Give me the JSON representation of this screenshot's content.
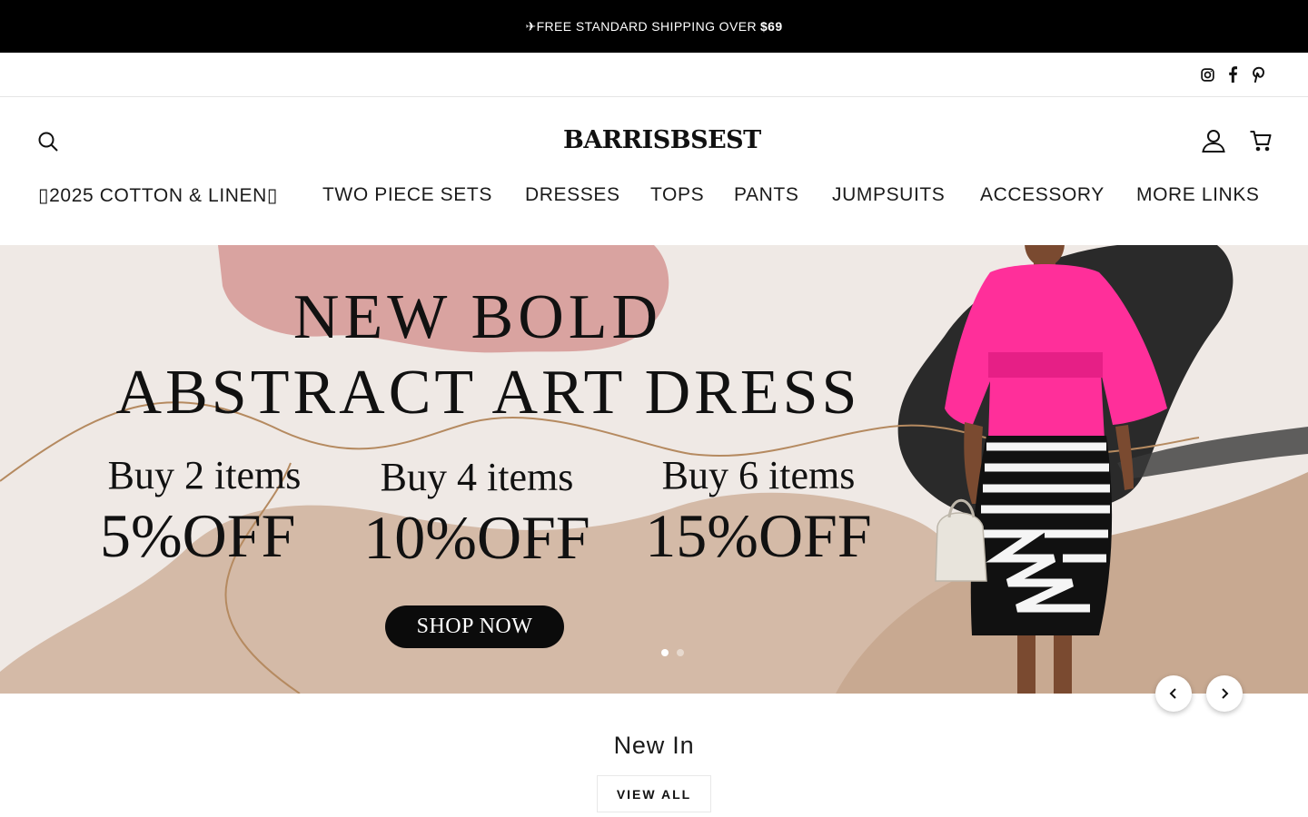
{
  "announcement": {
    "prefix": "✈FREE STANDARD SHIPPING OVER",
    "amount": "$69"
  },
  "social": {
    "icons": [
      "instagram-icon",
      "facebook-icon",
      "pinterest-icon"
    ]
  },
  "header": {
    "logo_text": "BARRISBSEST",
    "icons": {
      "search": "search-icon",
      "account": "user-icon",
      "cart": "cart-icon"
    }
  },
  "nav": {
    "items": [
      {
        "label": "▯2025 COTTON & LINEN▯"
      },
      {
        "label": "TWO PIECE SETS"
      },
      {
        "label": "DRESSES"
      },
      {
        "label": "TOPS"
      },
      {
        "label": "PANTS"
      },
      {
        "label": "JUMPSUITS"
      },
      {
        "label": "ACCESSORY"
      },
      {
        "label": "MORE LINKS"
      }
    ]
  },
  "hero": {
    "title_line1": "NEW BOLD",
    "title_line2": "ABSTRACT ART DRESS",
    "offers": [
      {
        "buy": "Buy 2 items",
        "discount": "5%OFF"
      },
      {
        "buy": "Buy 4 items",
        "discount": "10%OFF"
      },
      {
        "buy": "Buy 6 items",
        "discount": "15%OFF"
      }
    ],
    "cta": "SHOP NOW",
    "slide_count": 2,
    "active_slide": 1,
    "colors": {
      "dress_pink": "#ff2f9a",
      "blob_pink": "#d9a3a0",
      "blob_tan": "#c8a991",
      "background": "#efe9e5"
    }
  },
  "carousel": {
    "prev_icon": "chevron-left-icon",
    "next_icon": "chevron-right-icon"
  },
  "new_in": {
    "title": "New In",
    "view_all": "VIEW ALL"
  }
}
